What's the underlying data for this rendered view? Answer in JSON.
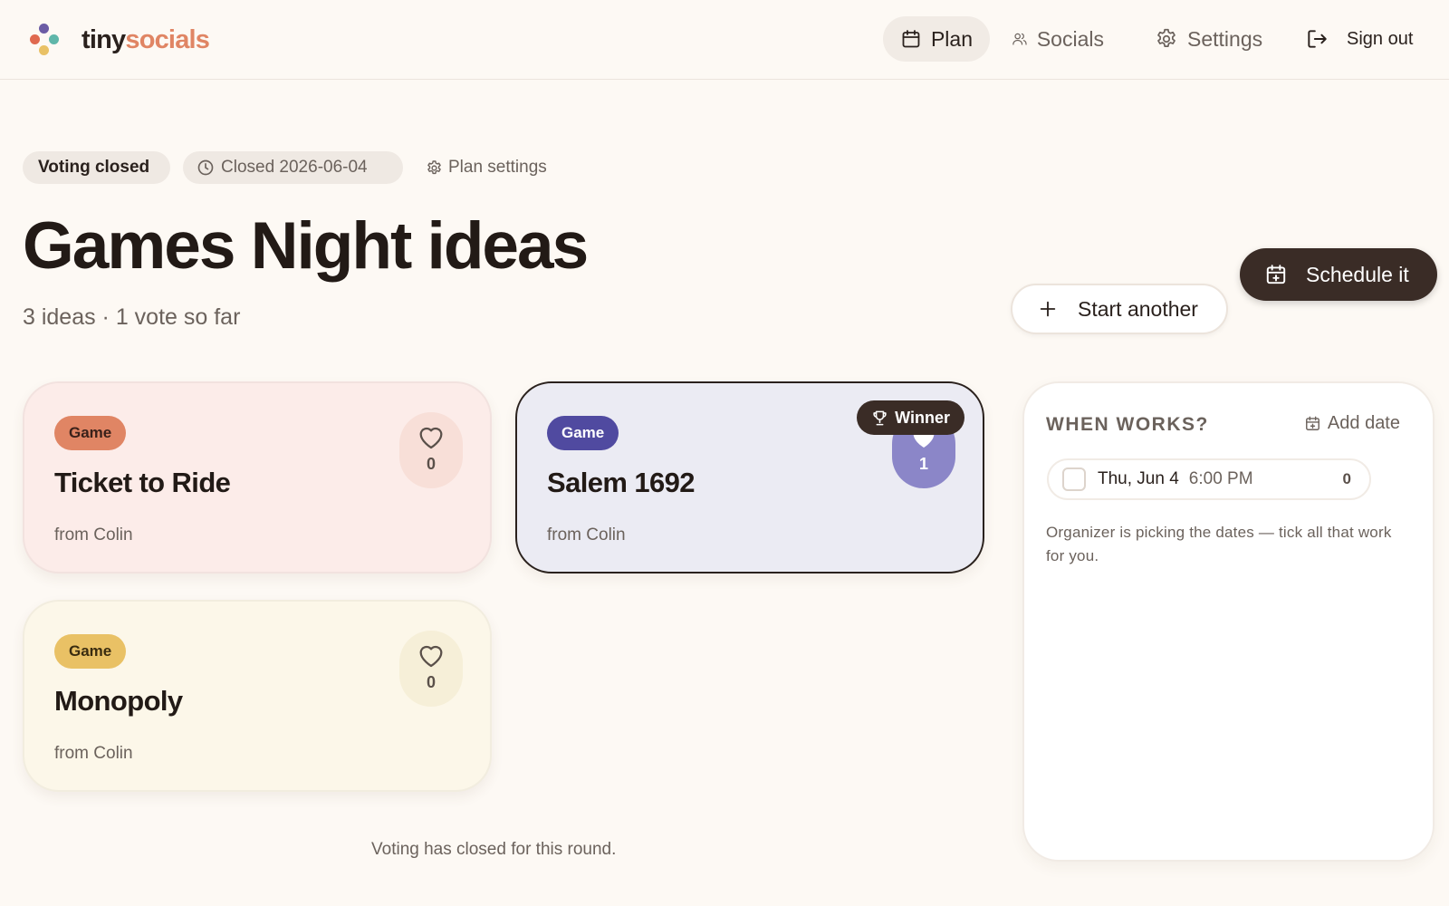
{
  "brand": {
    "name_part1": "tiny",
    "name_part2": "socials",
    "colors": {
      "purple": "#6b5ca5",
      "red": "#e0694f",
      "teal": "#5fb6a9",
      "yellow": "#e9c165"
    }
  },
  "nav": {
    "items": [
      {
        "label": "Plan",
        "icon": "calendar-icon",
        "active": true
      },
      {
        "label": "Socials",
        "icon": "users-icon",
        "active": false
      },
      {
        "label": "Settings",
        "icon": "gear-icon",
        "active": false
      }
    ],
    "sign_out": {
      "label": "Sign out",
      "icon": "sign-out-icon"
    }
  },
  "plan": {
    "status": "Voting closed",
    "closed_label": "Closed 2026-06-04",
    "settings_label": "Plan settings",
    "title": "Games Night ideas",
    "summary": "3 ideas · 1 vote so far"
  },
  "actions": {
    "start_another": "Start another",
    "schedule": "Schedule it"
  },
  "ideas": [
    {
      "tag": "Game",
      "title": "Ticket to Ride",
      "from": "from Colin",
      "votes": "0",
      "color": "#fcece9",
      "tag_color": "#e08564",
      "winner": false
    },
    {
      "tag": "Game",
      "title": "Salem 1692",
      "from": "from Colin",
      "votes": "1",
      "color": "#ebebf3",
      "tag_color": "#504aa0",
      "winner": true,
      "winner_label": "Winner"
    },
    {
      "tag": "Game",
      "title": "Monopoly",
      "from": "from Colin",
      "votes": "0",
      "color": "#fcf7e9",
      "tag_color": "#e9c165",
      "winner": false
    }
  ],
  "footer_note": "Voting has closed for this round.",
  "when_works": {
    "title": "WHEN WORKS?",
    "add_label": "Add date",
    "dates": [
      {
        "day": "Thu, Jun 4",
        "time": "6:00 PM",
        "count": "0",
        "checked": false
      }
    ],
    "note": "Organizer is picking the dates — tick all that work for you."
  }
}
